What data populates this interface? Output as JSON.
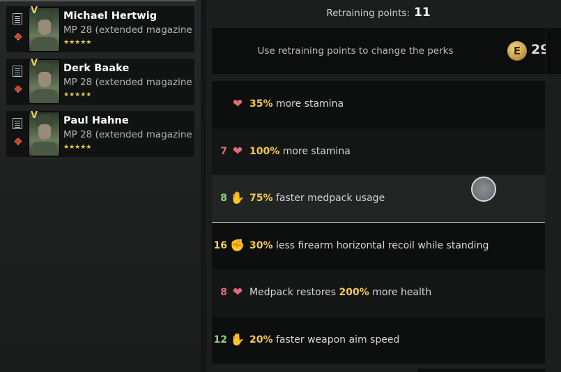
{
  "squad": [
    {
      "name": "Michael Hertwig",
      "weapon": "MP 28 (extended magazine",
      "stars": "★★★★★",
      "rank": "V"
    },
    {
      "name": "Derk Baake",
      "weapon": "MP 28 (extended magazine",
      "stars": "★★★★★",
      "rank": "V"
    },
    {
      "name": "Paul Hahne",
      "weapon": "MP 28 (extended magazine",
      "stars": "★★★★★",
      "rank": "V"
    }
  ],
  "retraining": {
    "label": "Retraining points:",
    "points": "11",
    "info": "Use retraining points to change the perks",
    "coin_glyph": "E",
    "coin_value": "29"
  },
  "perks": [
    {
      "cost": "",
      "icon": "heart-pulse-icon",
      "icon_glyph": "❤",
      "color": "#e46a7a",
      "hl": "35%",
      "text": " more stamina",
      "prefix": ""
    },
    {
      "cost": "7",
      "icon": "heart-pulse-icon",
      "icon_glyph": "❤",
      "color": "#e46a7a",
      "hl": "100%",
      "text": " more stamina",
      "prefix": ""
    },
    {
      "cost": "8",
      "icon": "hand-medkit-icon",
      "icon_glyph": "✋",
      "color": "#8ed27e",
      "hl": "75%",
      "text": " faster medpack usage",
      "prefix": ""
    },
    {
      "cost": "16",
      "icon": "fist-icon",
      "icon_glyph": "✊",
      "color": "#f0d44a",
      "hl": "30%",
      "text": " less firearm horizontal recoil while standing",
      "prefix": ""
    },
    {
      "cost": "8",
      "icon": "heart-pulse-icon",
      "icon_glyph": "❤",
      "color": "#e46a7a",
      "hl": "200%",
      "text": " more health",
      "prefix": "Medpack restores "
    },
    {
      "cost": "12",
      "icon": "hand-aim-icon",
      "icon_glyph": "✋",
      "color": "#8ed27e",
      "hl": "20%",
      "text": " faster weapon aim speed",
      "prefix": ""
    }
  ]
}
